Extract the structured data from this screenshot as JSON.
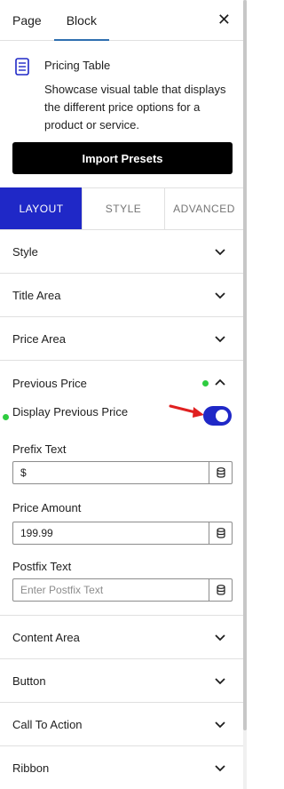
{
  "header": {
    "tabs": [
      "Page",
      "Block"
    ],
    "active_tab": "Block",
    "close_icon": "close-icon"
  },
  "block": {
    "icon": "pricing-table-icon",
    "title": "Pricing Table",
    "description": "Showcase visual table that displays the different price options for a product or service."
  },
  "import_label": "Import Presets",
  "mode_tabs": [
    "LAYOUT",
    "STYLE",
    "ADVANCED"
  ],
  "panels": {
    "style": "Style",
    "title_area": "Title Area",
    "price_area": "Price Area",
    "previous_price": "Previous Price",
    "content_area": "Content Area",
    "button": "Button",
    "call_to_action": "Call To Action",
    "ribbon": "Ribbon"
  },
  "previous_price": {
    "toggle_label": "Display Previous Price",
    "toggle_on": true,
    "prefix_label": "Prefix Text",
    "prefix_value": "$",
    "amount_label": "Price Amount",
    "amount_value": "199.99",
    "postfix_label": "Postfix Text",
    "postfix_placeholder": "Enter Postfix Text"
  },
  "colors": {
    "accent": "#1f28c7",
    "indicator": "#2ecc40",
    "arrow": "#e02020",
    "import_bg": "#000000"
  }
}
